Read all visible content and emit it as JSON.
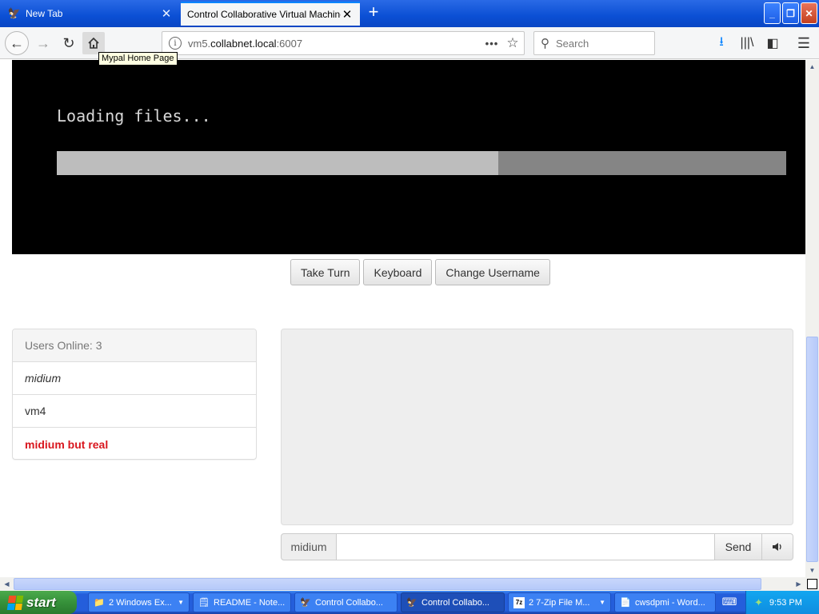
{
  "browser": {
    "tabs": [
      {
        "label": "New Tab",
        "icon": "mypal-icon"
      },
      {
        "label": "Control Collaborative Virtual Machines!",
        "icon": "none"
      }
    ],
    "url": {
      "prefix": "vm5.",
      "host": "collabnet.local",
      "port": ":6007"
    },
    "search_placeholder": "Search",
    "tooltip": "Mypal Home Page",
    "active_tab_accent": "#0a84ff"
  },
  "vm": {
    "loading_text": "Loading files...",
    "progress": 0.605
  },
  "controls": {
    "take_turn": "Take Turn",
    "keyboard": "Keyboard",
    "change_username": "Change Username"
  },
  "users": {
    "header": "Users Online: 3",
    "list": [
      {
        "name": "midium",
        "style": "italic"
      },
      {
        "name": "vm4",
        "style": "normal"
      },
      {
        "name": "midium but real",
        "style": "bold-red"
      }
    ],
    "highlight_color": "#d9161e"
  },
  "chat": {
    "username": "midium",
    "input_value": "",
    "send_label": "Send",
    "sound_icon": "speaker-icon"
  },
  "taskbar": {
    "start_label": "start",
    "tasks": [
      {
        "label": "2 Windows Ex...",
        "icon": "folder-icon",
        "group": true
      },
      {
        "label": "README - Note...",
        "icon": "notepad-icon",
        "group": false
      },
      {
        "label": "Control Collabo...",
        "icon": "mypal-icon",
        "group": false
      },
      {
        "label": "Control Collabo...",
        "icon": "mypal-icon",
        "group": false,
        "active": true
      },
      {
        "label": "2 7-Zip File M...",
        "icon": "7zip-icon",
        "group": true
      },
      {
        "label": "cwsdpmi - Word...",
        "icon": "wordpad-icon",
        "group": false
      }
    ],
    "clock": "9:53 PM"
  }
}
